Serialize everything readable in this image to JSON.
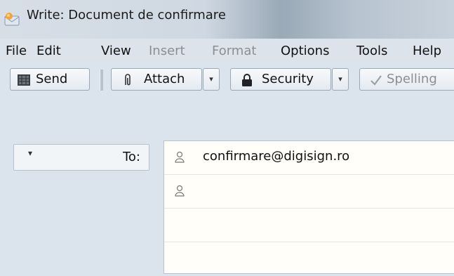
{
  "window": {
    "title": "Write: Document de confirmare"
  },
  "menu": {
    "file": "File",
    "edit": "Edit",
    "view": "View",
    "insert": "Insert",
    "format": "Format",
    "options": "Options",
    "tools": "Tools",
    "help": "Help"
  },
  "toolbar": {
    "send": "Send",
    "attach": "Attach",
    "security": "Security",
    "spelling": "Spelling"
  },
  "address": {
    "field_label": "To:",
    "recipients": [
      "confirmare@digisign.ro",
      "",
      "",
      ""
    ]
  },
  "colors": {
    "background": "#dbe3ec",
    "text": "#111111",
    "disabled_text": "#8b8f94",
    "address_bg": "#fffef8"
  }
}
